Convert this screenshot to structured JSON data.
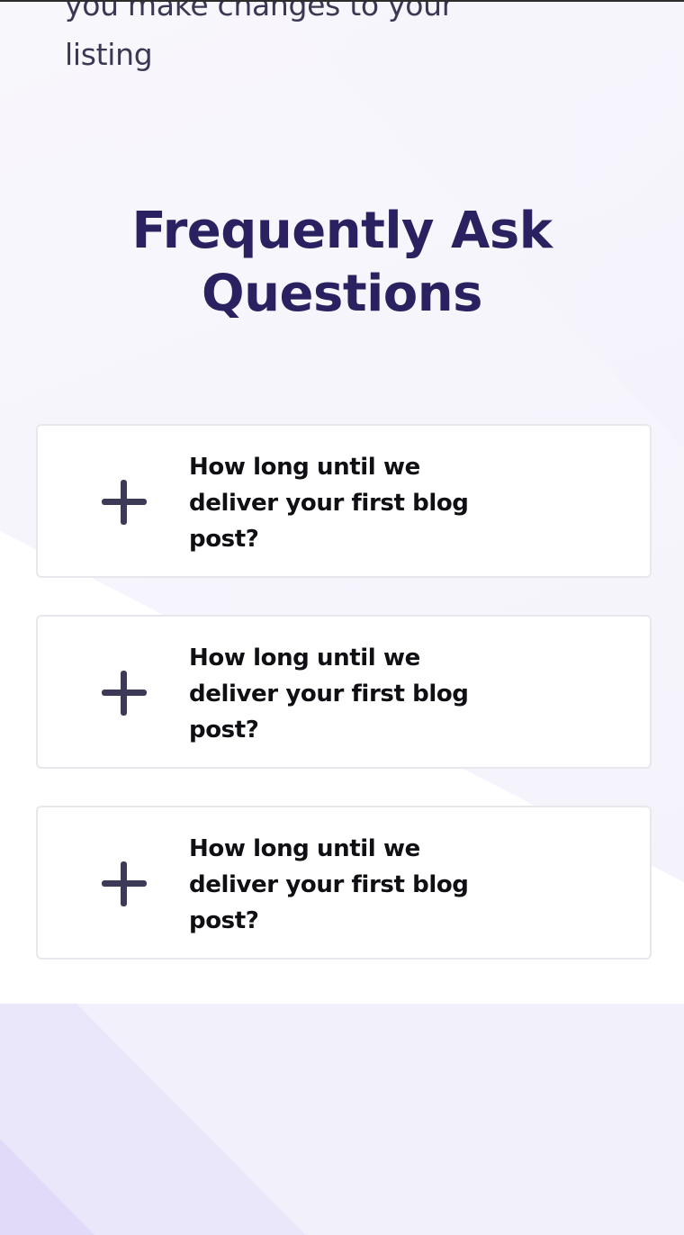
{
  "intro": {
    "line1": "you make changes to your",
    "line2": "listing"
  },
  "faq": {
    "title_line1": "Frequently Ask",
    "title_line2": "Questions",
    "items": [
      {
        "icon": "plus-icon",
        "question": "How long until we deliver your first blog post?"
      },
      {
        "icon": "plus-icon",
        "question": "How long until we deliver your first blog post?"
      },
      {
        "icon": "plus-icon",
        "question": "How long until we deliver your first blog post?"
      }
    ]
  },
  "colors": {
    "heading": "#2a2160",
    "body_text": "#3a3852",
    "icon": "#3d3a58",
    "card_border": "#e8e7ee"
  }
}
